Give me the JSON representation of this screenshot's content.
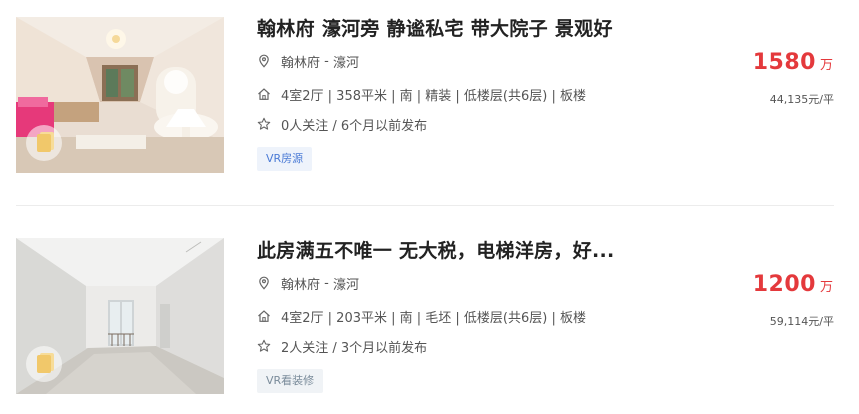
{
  "listings": [
    {
      "title": "翰林府 濠河旁 静谧私宅 带大院子 景观好",
      "community": "翰林府",
      "separator": " - ",
      "district": "濠河",
      "house_info": "4室2厅 | 358平米 | 南 | 精装 | 低楼层(共6层) | 板楼",
      "follow_info": "0人关注 / 6个月以前发布",
      "tag": "VR房源",
      "total_price": "1580",
      "price_unit": "万",
      "unit_price": "44,135元/平",
      "icons": [
        "location-icon",
        "house-icon",
        "star-icon"
      ]
    },
    {
      "title": "此房满五不唯一 无大税，电梯洋房，好...",
      "community": "翰林府",
      "separator": " - ",
      "district": "濠河",
      "house_info": "4室2厅 | 203平米 | 南 | 毛坯 | 低楼层(共6层) | 板楼",
      "follow_info": "2人关注 / 3个月以前发布",
      "tag": "VR看装修",
      "total_price": "1200",
      "price_unit": "万",
      "unit_price": "59,114元/平",
      "icons": [
        "location-icon",
        "house-icon",
        "star-icon"
      ]
    }
  ],
  "colors": {
    "price": "#e4393c",
    "title": "#222222",
    "text": "#555555",
    "tag_blue_bg": "#eef3fb",
    "tag_blue_text": "#4b7bd6",
    "tag_gray_bg": "#f0f3f6",
    "tag_gray_text": "#7a8b9a"
  }
}
